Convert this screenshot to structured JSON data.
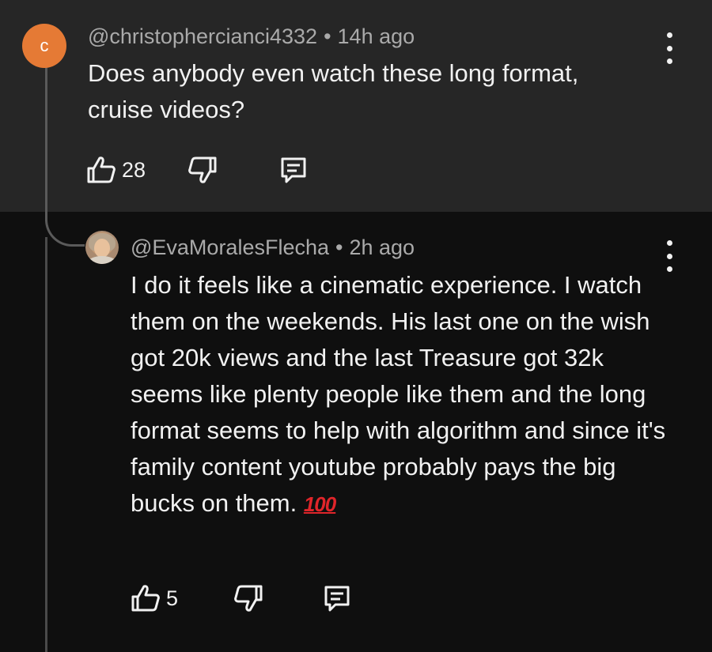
{
  "comments": [
    {
      "avatar_letter": "c",
      "avatar_color": "#e57a35",
      "author": "@christophercianci4332",
      "separator": "•",
      "time": "14h ago",
      "text": "Does anybody even watch these long format, cruise videos?",
      "likes": "28",
      "background": "#262626"
    },
    {
      "author": "@EvaMoralesFlecha",
      "separator": "•",
      "time": "2h ago",
      "text": "I do it feels like a cinematic experience. I watch them on the weekends. His last one on the wish got 20k views and the last Treasure got 32k seems like plenty people like them and the long format seems to help with algorithm and since it's family content youtube probably pays the big bucks on them.",
      "emoji": "💯",
      "emoji_text": "100",
      "likes": "5",
      "background": "#0f0f0f"
    }
  ],
  "icons": {
    "like": "thumbs-up-icon",
    "dislike": "thumbs-down-icon",
    "reply": "reply-comment-icon",
    "more": "more-vertical-icon"
  }
}
